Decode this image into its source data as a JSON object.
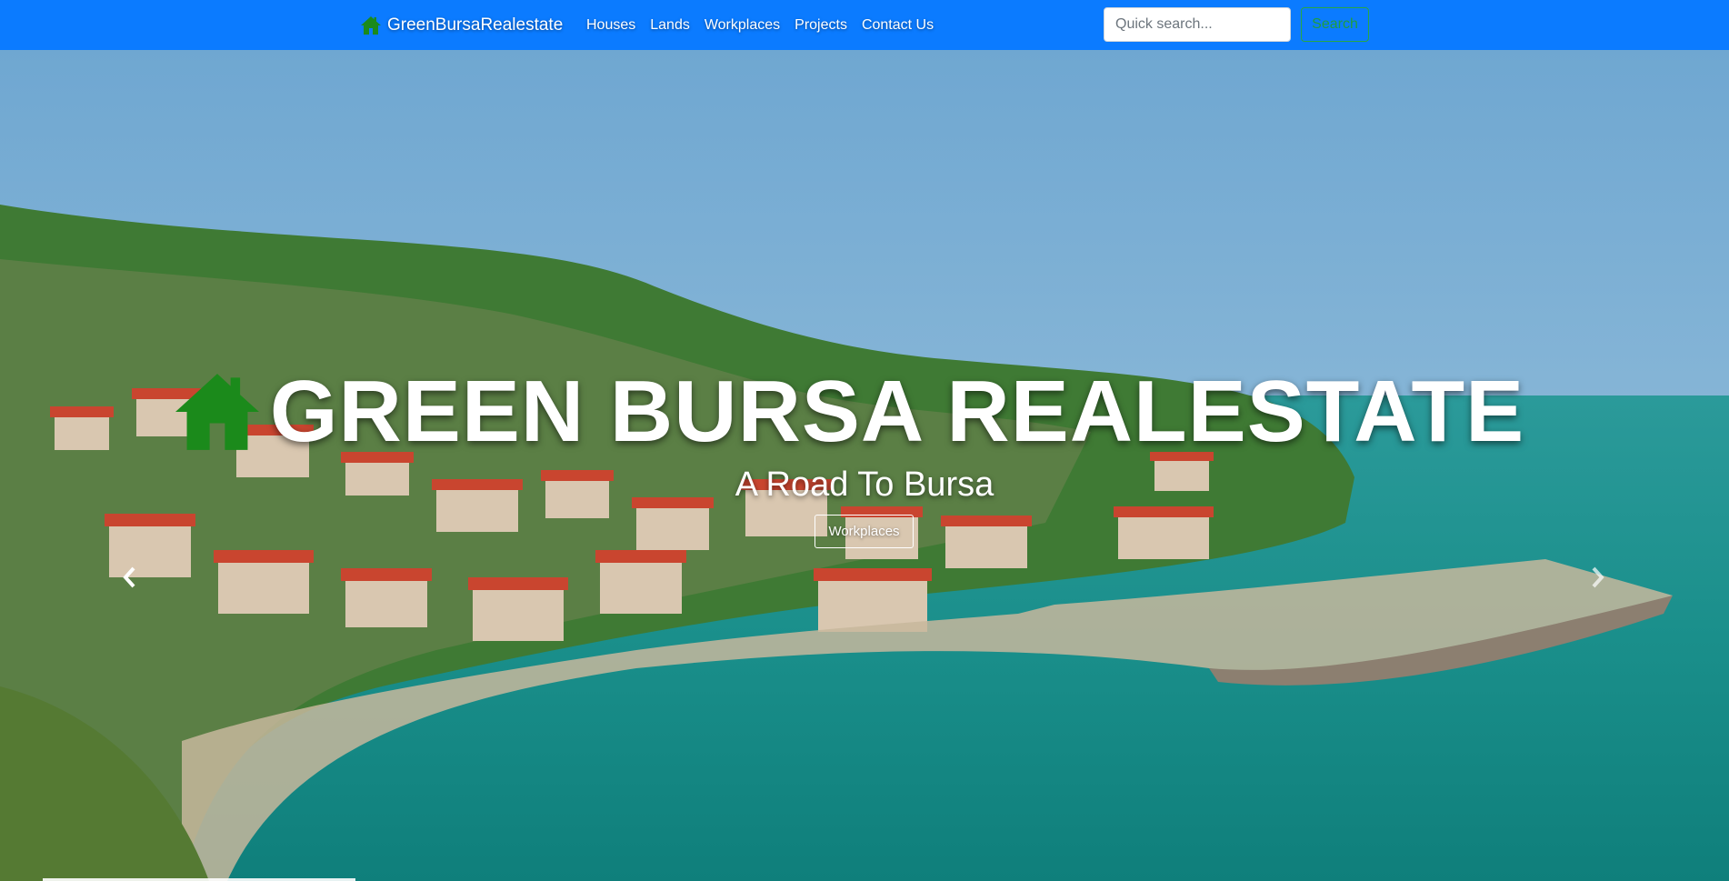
{
  "nav": {
    "brand": "GreenBursaRealestate",
    "links": [
      "Houses",
      "Lands",
      "Workplaces",
      "Projects",
      "Contact Us"
    ],
    "search_placeholder": "Quick search...",
    "search_button": "Search"
  },
  "hero": {
    "title": "GREEN BURSA REALESTATE",
    "subtitle": "A Road To Bursa",
    "button": "Workplaces",
    "prev_icon": "chevron-left-icon",
    "next_icon": "chevron-right-icon"
  },
  "colors": {
    "navbar": "#0b7bff",
    "brand_icon": "#1b8a1b",
    "search_button": "#28a745"
  }
}
